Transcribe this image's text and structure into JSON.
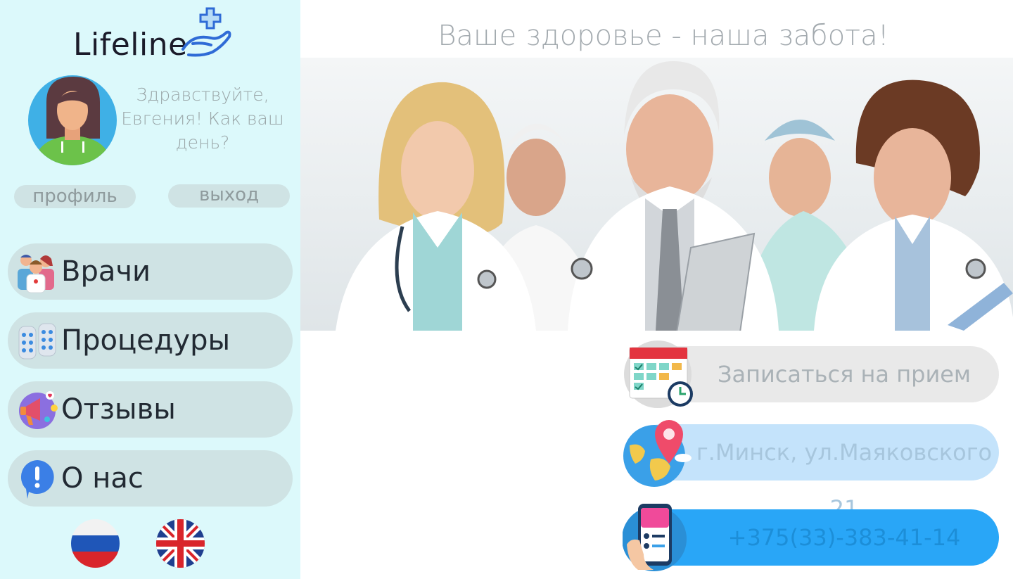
{
  "brand": {
    "name": "Lifeline"
  },
  "sidebar": {
    "greeting": "Здравствуйте, Евгения! Как ваш день?",
    "profile_label": "профиль",
    "logout_label": "выход",
    "nav": [
      {
        "label": "Врачи",
        "icon": "doctors-icon"
      },
      {
        "label": "Процедуры",
        "icon": "pills-icon"
      },
      {
        "label": "Отзывы",
        "icon": "megaphone-icon"
      },
      {
        "label": "О нас",
        "icon": "info-icon"
      }
    ],
    "languages": [
      {
        "code": "ru",
        "icon": "russia-flag-icon"
      },
      {
        "code": "en",
        "icon": "uk-flag-icon"
      }
    ]
  },
  "main": {
    "headline": "Ваше здоровье - наша забота!",
    "actions": {
      "appointment": "Записаться на прием",
      "address": "г.Минск, ул.Маяковского 21",
      "phone": "+375(33)-383-41-14"
    }
  },
  "colors": {
    "sidebar_bg": "#dcf9fb",
    "pill_bg": "#cfe3e4",
    "address_bg": "#c4e3fb",
    "phone_bg": "#29a6f7",
    "brand_blue": "#2f6bd6"
  }
}
